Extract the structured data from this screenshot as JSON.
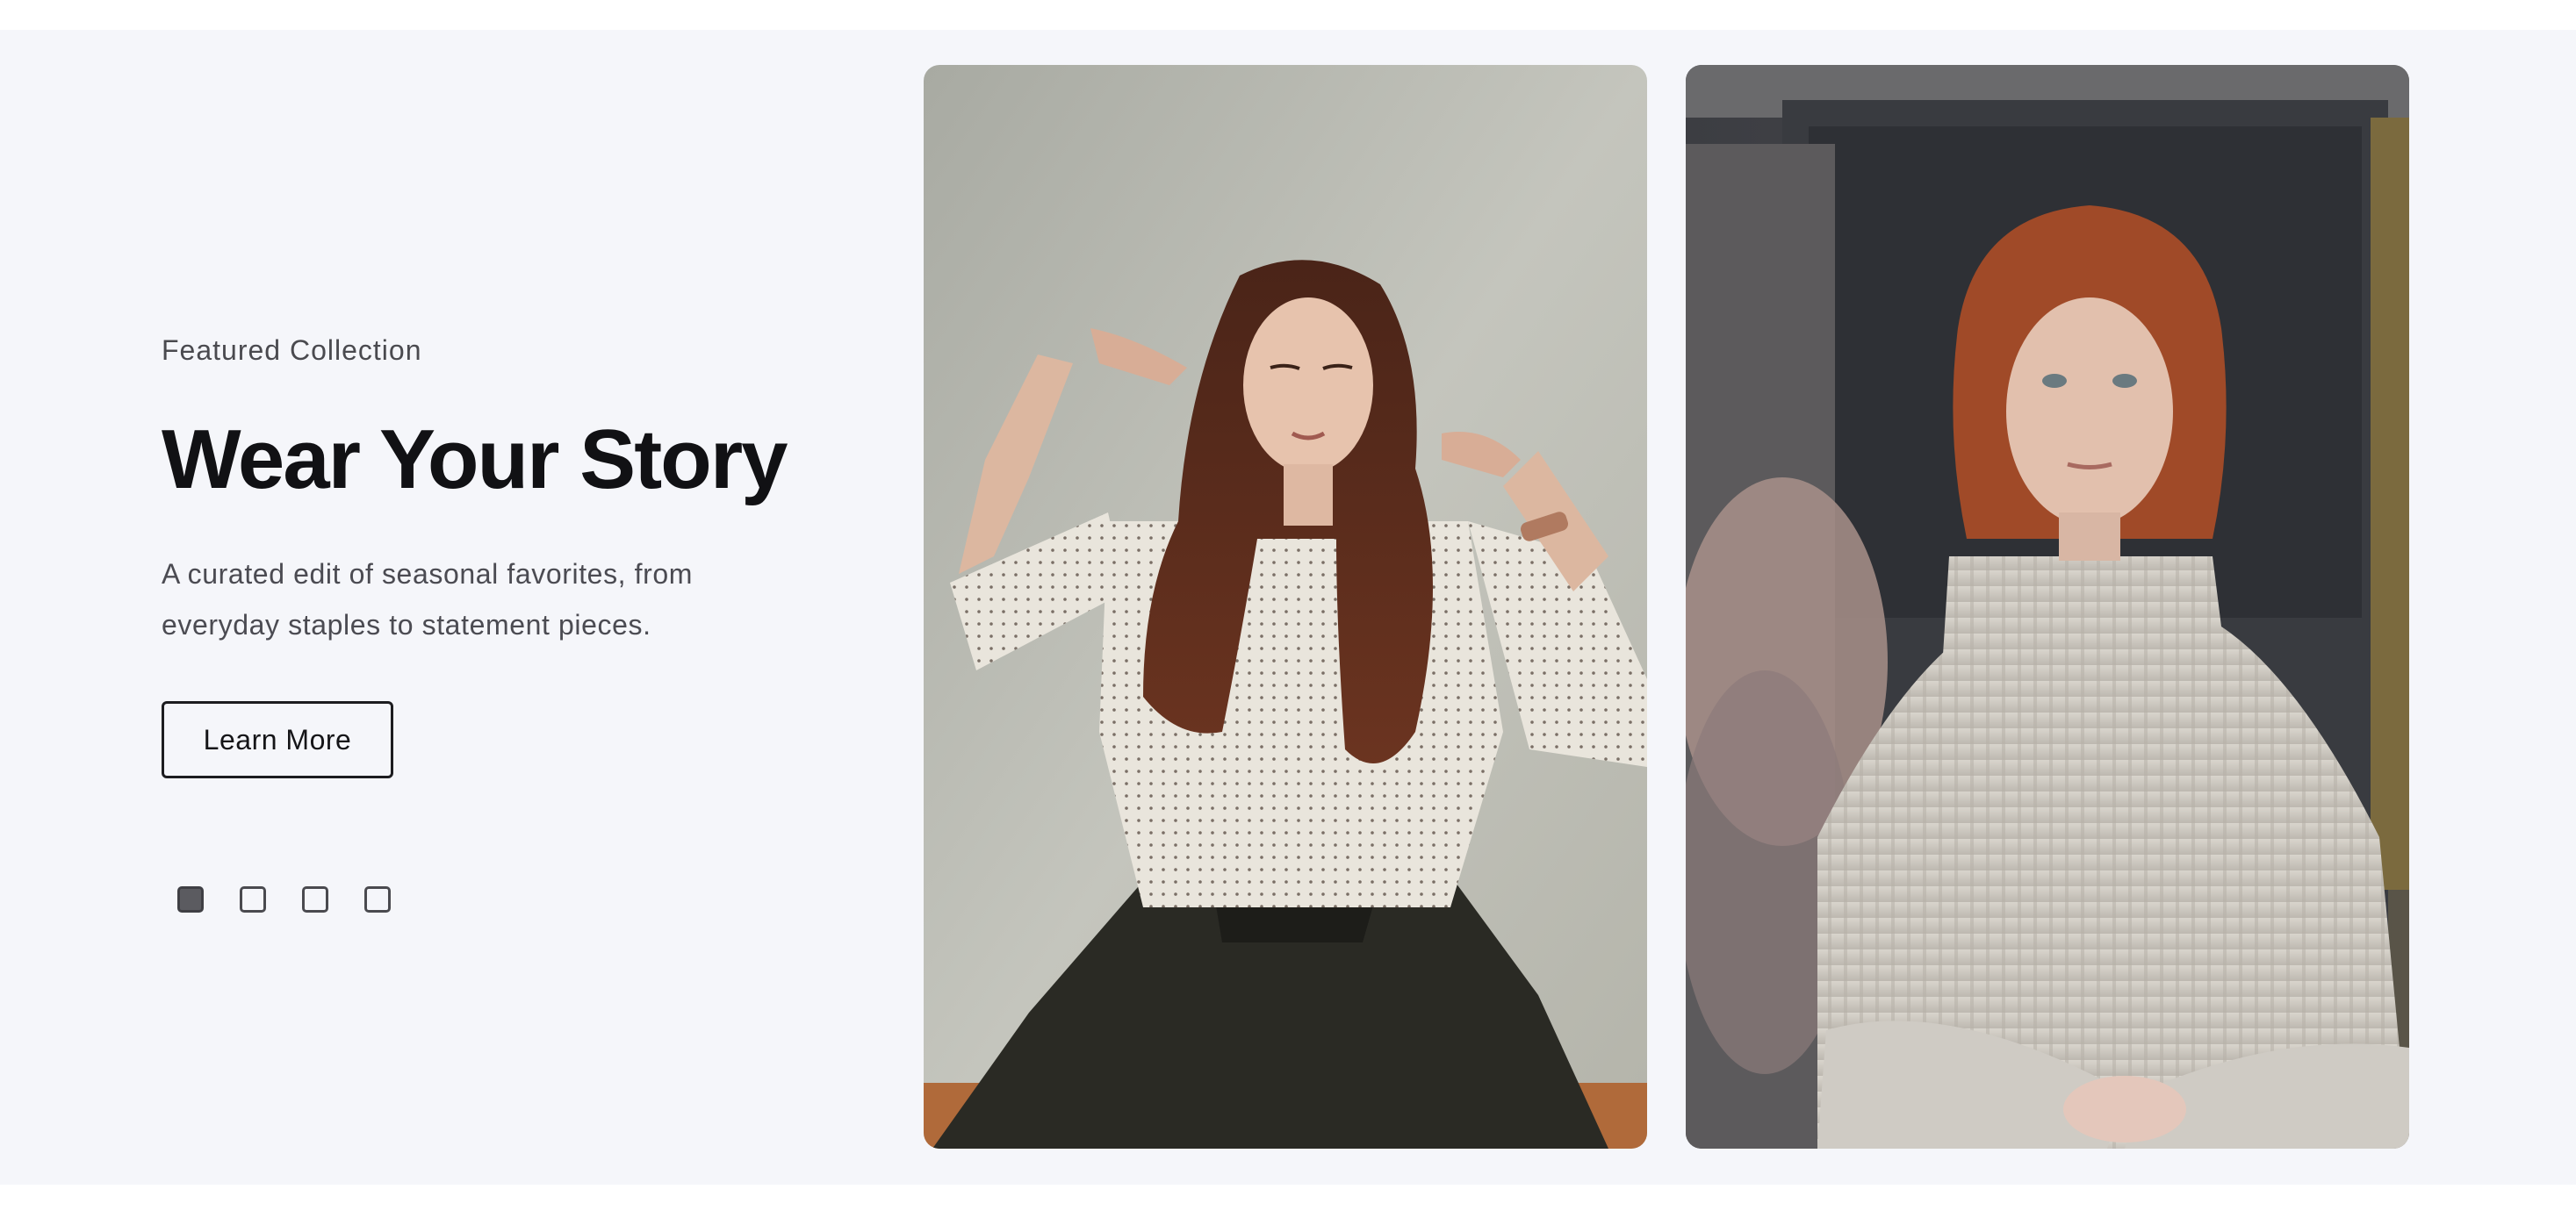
{
  "hero": {
    "eyebrow": "Featured Collection",
    "title": "Wear Your Story",
    "description": "A curated edit of seasonal favorites, from everyday staples to statement pieces.",
    "cta_label": "Learn More",
    "carousel": {
      "total_slides": 4,
      "active_index": 0
    }
  },
  "images": [
    {
      "name": "model-polka-dot-blouse-photo"
    },
    {
      "name": "model-turtleneck-sweater-photo"
    }
  ],
  "colors": {
    "background": "#f5f6fa",
    "text_primary": "#111114",
    "text_secondary": "#4b4b52",
    "active_dot": "#5b5b60"
  }
}
